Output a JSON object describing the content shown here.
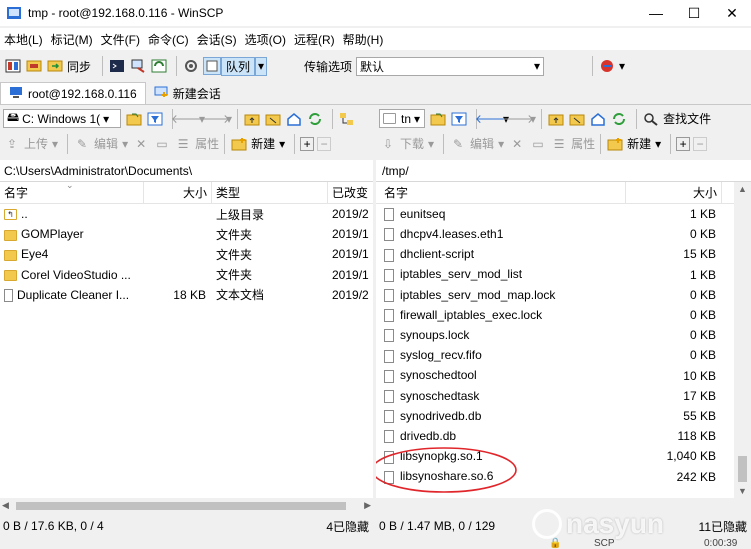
{
  "title": "tmp - root@192.168.0.116 - WinSCP",
  "window_buttons": {
    "minimize": "—",
    "maximize": "☐",
    "close": "✕"
  },
  "menu": [
    "本地(L)",
    "标记(M)",
    "文件(F)",
    "命令(C)",
    "会话(S)",
    "选项(O)",
    "远程(R)",
    "帮助(H)"
  ],
  "toolbar": {
    "sync": "同步",
    "queue": "队列",
    "transfer_label": "传输选项",
    "transfer_value": "默认"
  },
  "tabs": {
    "session": "root@192.168.0.116",
    "new_session": "新建会话"
  },
  "left": {
    "drive": "C: Windows 1(",
    "upload": "上传",
    "edit": "编辑",
    "props": "属性",
    "new": "新建",
    "path": "C:\\Users\\Administrator\\Documents\\",
    "headers": {
      "name": "名字",
      "size": "大小",
      "type": "类型",
      "changed": "已改变"
    },
    "rows": [
      {
        "name": "..",
        "size": "",
        "type": "上级目录",
        "changed": "2019/2"
      },
      {
        "name": "GOMPlayer",
        "size": "",
        "type": "文件夹",
        "changed": "2019/1"
      },
      {
        "name": "Eye4",
        "size": "",
        "type": "文件夹",
        "changed": "2019/1"
      },
      {
        "name": "Corel VideoStudio ...",
        "size": "",
        "type": "文件夹",
        "changed": "2019/1"
      },
      {
        "name": "Duplicate Cleaner I...",
        "size": "18 KB",
        "type": "文本文档",
        "changed": "2019/2"
      }
    ],
    "status": "0 B / 17.6 KB,  0 / 4",
    "hidden": "4已隐藏"
  },
  "right": {
    "dir": "tn",
    "download": "下载",
    "edit": "编辑",
    "props": "属性",
    "new": "新建",
    "find": "查找文件",
    "path": "/tmp/",
    "headers": {
      "name": "名字",
      "size": "大小"
    },
    "rows": [
      {
        "name": "eunitseq",
        "size": "1 KB"
      },
      {
        "name": "dhcpv4.leases.eth1",
        "size": "0 KB"
      },
      {
        "name": "dhclient-script",
        "size": "15 KB"
      },
      {
        "name": "iptables_serv_mod_list",
        "size": "1 KB"
      },
      {
        "name": "iptables_serv_mod_map.lock",
        "size": "0 KB"
      },
      {
        "name": "firewall_iptables_exec.lock",
        "size": "0 KB"
      },
      {
        "name": "synoups.lock",
        "size": "0 KB"
      },
      {
        "name": "syslog_recv.fifo",
        "size": "0 KB"
      },
      {
        "name": "synoschedtool",
        "size": "10 KB"
      },
      {
        "name": "synoschedtask",
        "size": "17 KB"
      },
      {
        "name": "synodrivedb.db",
        "size": "55 KB"
      },
      {
        "name": "drivedb.db",
        "size": "118 KB"
      },
      {
        "name": "libsynopkg.so.1",
        "size": "1,040 KB"
      },
      {
        "name": "libsynoshare.so.6",
        "size": "242 KB"
      }
    ],
    "status": "0 B / 1.47 MB,  0 / 129",
    "hidden": "11已隐藏",
    "protocol": "SCP",
    "time": "0:00:39"
  },
  "watermark": "nasyun",
  "colors": {
    "folder": "#f2c94c",
    "annotation": "#e0262b",
    "selected_tab": "#ffffff"
  }
}
